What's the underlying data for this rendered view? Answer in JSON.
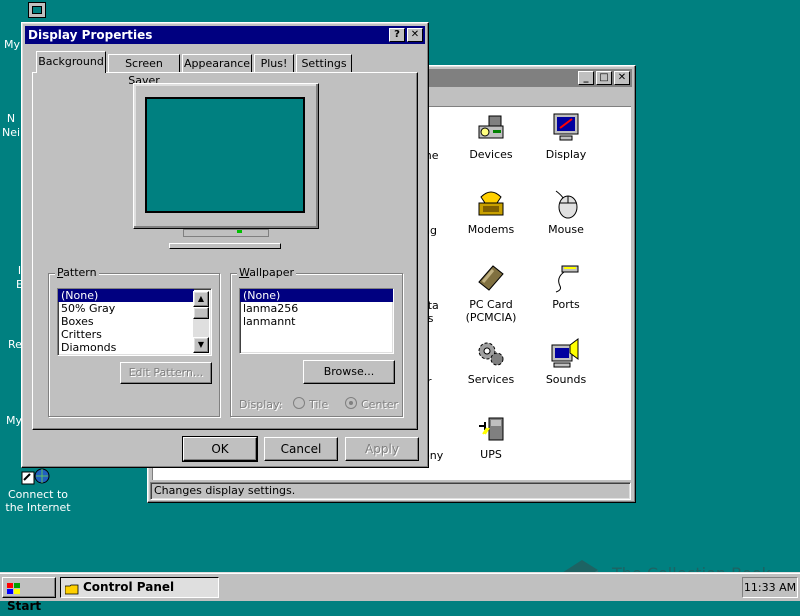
{
  "desktop": {
    "icons": [
      {
        "label": "My",
        "icon": "computer-icon"
      },
      {
        "label": "N\nNei",
        "icon": "network-icon"
      },
      {
        "label": "I\nE",
        "icon": "inbox-icon"
      },
      {
        "label": "Re",
        "icon": "recycle-bin-icon"
      },
      {
        "label": "My",
        "icon": "briefcase-icon"
      },
      {
        "label": "Connect to the Internet",
        "icon": "internet-icon"
      }
    ]
  },
  "control_panel": {
    "status": "Changes display settings.",
    "items": [
      {
        "label": "me",
        "icon": "partial-icon"
      },
      {
        "label": "Devices",
        "icon": "devices-icon"
      },
      {
        "label": "Display",
        "icon": "display-icon"
      },
      {
        "label": "ng",
        "icon": "partial-icon"
      },
      {
        "label": "Modems",
        "icon": "modem-icon"
      },
      {
        "label": "Mouse",
        "icon": "mouse-icon"
      },
      {
        "label": "ata\nes",
        "icon": "partial-icon"
      },
      {
        "label": "PC Card\n(PCMCIA)",
        "icon": "pc-card-icon"
      },
      {
        "label": "Ports",
        "icon": "ports-icon"
      },
      {
        "label": "r",
        "icon": "partial-icon"
      },
      {
        "label": "Services",
        "icon": "services-icon"
      },
      {
        "label": "Sounds",
        "icon": "sounds-icon"
      },
      {
        "label": "ony",
        "icon": "partial-icon"
      },
      {
        "label": "UPS",
        "icon": "ups-icon"
      }
    ]
  },
  "dialog": {
    "title": "Display Properties",
    "help_btn": "?",
    "close_btn": "✕",
    "tabs": [
      "Background",
      "Screen Saver",
      "Appearance",
      "Plus!",
      "Settings"
    ],
    "active_tab": "Background",
    "monitor_color": "#008080",
    "pattern": {
      "label": "Pattern",
      "items": [
        "(None)",
        "50% Gray",
        "Boxes",
        "Critters",
        "Diamonds"
      ],
      "selected": "(None)",
      "edit_button": "Edit Pattern..."
    },
    "wallpaper": {
      "label": "Wallpaper",
      "items": [
        "(None)",
        "lanma256",
        "lanmannt"
      ],
      "selected": "(None)",
      "browse_button": "Browse...",
      "display_label": "Display:",
      "tile_label": "Tile",
      "center_label": "Center",
      "selected_display": "Center"
    },
    "buttons": {
      "ok": "OK",
      "cancel": "Cancel",
      "apply": "Apply"
    }
  },
  "taskbar": {
    "start": "Start",
    "task": "Control Panel",
    "clock": "11:33 AM"
  },
  "watermark": "The Collection Book"
}
